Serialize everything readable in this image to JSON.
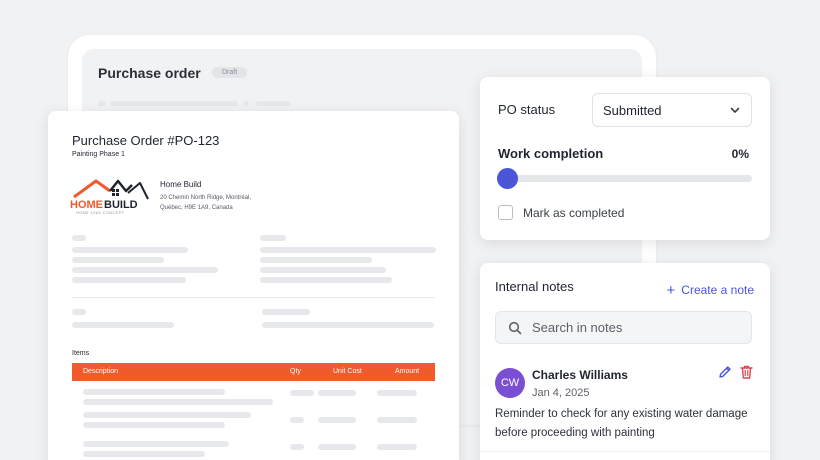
{
  "background_card": {
    "title": "Purchase order",
    "badge": "Draft"
  },
  "document": {
    "title": "Purchase Order #PO-123",
    "subtitle": "Painting Phase 1",
    "logo": {
      "wordmark": "HOMEBUILD",
      "tagline": "HOME 1984 CONCEPT",
      "colors": {
        "primary": "#f15a2b",
        "secondary": "#1f2430"
      }
    },
    "company": {
      "name": "Home Build",
      "address_line1": "20 Chemin North Ridge, Montréal,",
      "address_line2": "Québec, H9E 1A9, Canada"
    },
    "items_label": "Items",
    "items_columns": [
      "Description",
      "Qty",
      "Unit Cost",
      "Amount"
    ]
  },
  "status_panel": {
    "status_label": "PO status",
    "status_value": "Submitted",
    "work_completion_label": "Work completion",
    "work_completion_value": "0%",
    "work_completion_fraction": 0,
    "mark_completed_label": "Mark as completed",
    "mark_completed_checked": false
  },
  "notes_panel": {
    "title": "Internal notes",
    "create_label": "Create a note",
    "search_placeholder": "Search in notes",
    "notes": [
      {
        "initials": "CW",
        "author": "Charles Williams",
        "date": "Jan 4, 2025",
        "text": "Reminder to check for any existing water damage before proceeding with painting"
      }
    ]
  },
  "colors": {
    "accent": "#4a55d8",
    "brand_orange": "#f15a2b",
    "avatar": "#7a4fd3",
    "delete": "#e0454f"
  },
  "icons": [
    "chevron-down-icon",
    "plus-icon",
    "search-icon",
    "edit-icon",
    "trash-icon"
  ]
}
